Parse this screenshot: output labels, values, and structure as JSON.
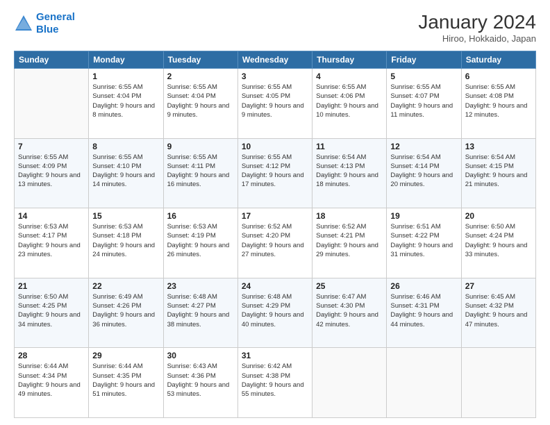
{
  "header": {
    "logo_line1": "General",
    "logo_line2": "Blue",
    "month_title": "January 2024",
    "location": "Hiroo, Hokkaido, Japan"
  },
  "days_of_week": [
    "Sunday",
    "Monday",
    "Tuesday",
    "Wednesday",
    "Thursday",
    "Friday",
    "Saturday"
  ],
  "weeks": [
    [
      {
        "day": "",
        "sunrise": "",
        "sunset": "",
        "daylight": ""
      },
      {
        "day": "1",
        "sunrise": "6:55 AM",
        "sunset": "4:04 PM",
        "daylight": "9 hours and 8 minutes."
      },
      {
        "day": "2",
        "sunrise": "6:55 AM",
        "sunset": "4:04 PM",
        "daylight": "9 hours and 9 minutes."
      },
      {
        "day": "3",
        "sunrise": "6:55 AM",
        "sunset": "4:05 PM",
        "daylight": "9 hours and 9 minutes."
      },
      {
        "day": "4",
        "sunrise": "6:55 AM",
        "sunset": "4:06 PM",
        "daylight": "9 hours and 10 minutes."
      },
      {
        "day": "5",
        "sunrise": "6:55 AM",
        "sunset": "4:07 PM",
        "daylight": "9 hours and 11 minutes."
      },
      {
        "day": "6",
        "sunrise": "6:55 AM",
        "sunset": "4:08 PM",
        "daylight": "9 hours and 12 minutes."
      }
    ],
    [
      {
        "day": "7",
        "sunrise": "6:55 AM",
        "sunset": "4:09 PM",
        "daylight": "9 hours and 13 minutes."
      },
      {
        "day": "8",
        "sunrise": "6:55 AM",
        "sunset": "4:10 PM",
        "daylight": "9 hours and 14 minutes."
      },
      {
        "day": "9",
        "sunrise": "6:55 AM",
        "sunset": "4:11 PM",
        "daylight": "9 hours and 16 minutes."
      },
      {
        "day": "10",
        "sunrise": "6:55 AM",
        "sunset": "4:12 PM",
        "daylight": "9 hours and 17 minutes."
      },
      {
        "day": "11",
        "sunrise": "6:54 AM",
        "sunset": "4:13 PM",
        "daylight": "9 hours and 18 minutes."
      },
      {
        "day": "12",
        "sunrise": "6:54 AM",
        "sunset": "4:14 PM",
        "daylight": "9 hours and 20 minutes."
      },
      {
        "day": "13",
        "sunrise": "6:54 AM",
        "sunset": "4:15 PM",
        "daylight": "9 hours and 21 minutes."
      }
    ],
    [
      {
        "day": "14",
        "sunrise": "6:53 AM",
        "sunset": "4:17 PM",
        "daylight": "9 hours and 23 minutes."
      },
      {
        "day": "15",
        "sunrise": "6:53 AM",
        "sunset": "4:18 PM",
        "daylight": "9 hours and 24 minutes."
      },
      {
        "day": "16",
        "sunrise": "6:53 AM",
        "sunset": "4:19 PM",
        "daylight": "9 hours and 26 minutes."
      },
      {
        "day": "17",
        "sunrise": "6:52 AM",
        "sunset": "4:20 PM",
        "daylight": "9 hours and 27 minutes."
      },
      {
        "day": "18",
        "sunrise": "6:52 AM",
        "sunset": "4:21 PM",
        "daylight": "9 hours and 29 minutes."
      },
      {
        "day": "19",
        "sunrise": "6:51 AM",
        "sunset": "4:22 PM",
        "daylight": "9 hours and 31 minutes."
      },
      {
        "day": "20",
        "sunrise": "6:50 AM",
        "sunset": "4:24 PM",
        "daylight": "9 hours and 33 minutes."
      }
    ],
    [
      {
        "day": "21",
        "sunrise": "6:50 AM",
        "sunset": "4:25 PM",
        "daylight": "9 hours and 34 minutes."
      },
      {
        "day": "22",
        "sunrise": "6:49 AM",
        "sunset": "4:26 PM",
        "daylight": "9 hours and 36 minutes."
      },
      {
        "day": "23",
        "sunrise": "6:48 AM",
        "sunset": "4:27 PM",
        "daylight": "9 hours and 38 minutes."
      },
      {
        "day": "24",
        "sunrise": "6:48 AM",
        "sunset": "4:29 PM",
        "daylight": "9 hours and 40 minutes."
      },
      {
        "day": "25",
        "sunrise": "6:47 AM",
        "sunset": "4:30 PM",
        "daylight": "9 hours and 42 minutes."
      },
      {
        "day": "26",
        "sunrise": "6:46 AM",
        "sunset": "4:31 PM",
        "daylight": "9 hours and 44 minutes."
      },
      {
        "day": "27",
        "sunrise": "6:45 AM",
        "sunset": "4:32 PM",
        "daylight": "9 hours and 47 minutes."
      }
    ],
    [
      {
        "day": "28",
        "sunrise": "6:44 AM",
        "sunset": "4:34 PM",
        "daylight": "9 hours and 49 minutes."
      },
      {
        "day": "29",
        "sunrise": "6:44 AM",
        "sunset": "4:35 PM",
        "daylight": "9 hours and 51 minutes."
      },
      {
        "day": "30",
        "sunrise": "6:43 AM",
        "sunset": "4:36 PM",
        "daylight": "9 hours and 53 minutes."
      },
      {
        "day": "31",
        "sunrise": "6:42 AM",
        "sunset": "4:38 PM",
        "daylight": "9 hours and 55 minutes."
      },
      {
        "day": "",
        "sunrise": "",
        "sunset": "",
        "daylight": ""
      },
      {
        "day": "",
        "sunrise": "",
        "sunset": "",
        "daylight": ""
      },
      {
        "day": "",
        "sunrise": "",
        "sunset": "",
        "daylight": ""
      }
    ]
  ],
  "labels": {
    "sunrise_prefix": "Sunrise:",
    "sunset_prefix": "Sunset:",
    "daylight_prefix": "Daylight:"
  }
}
